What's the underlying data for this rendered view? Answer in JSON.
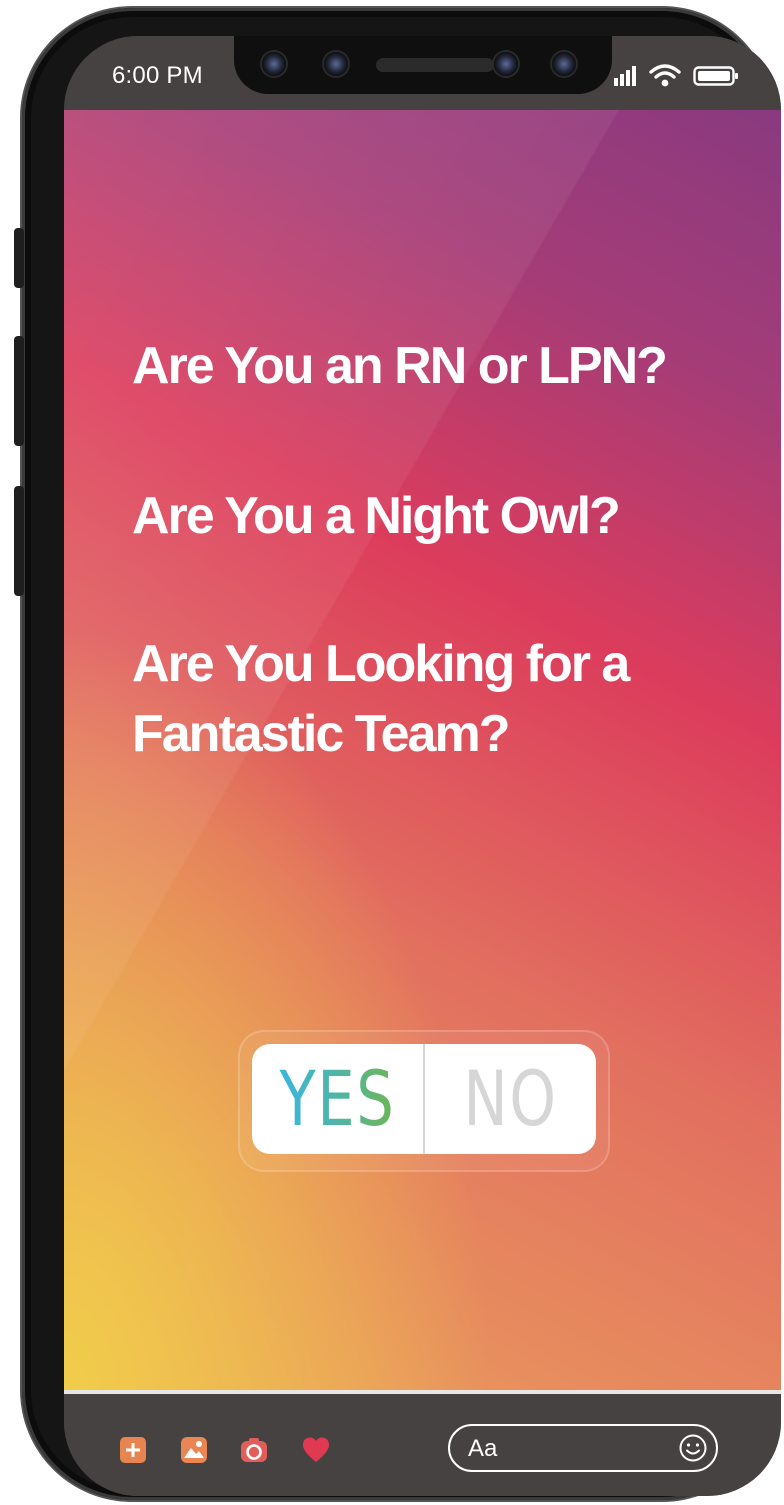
{
  "status_bar": {
    "time": "6:00 PM",
    "icons": [
      "signal-icon",
      "wifi-icon",
      "battery-icon"
    ]
  },
  "story": {
    "headlines": [
      "Are You an RN or LPN?",
      "Are You a Night Owl?",
      "Are You Looking for a",
      "Fantastic Team?"
    ],
    "poll": {
      "yes_label": "YES",
      "no_label": "NO"
    },
    "colors": {
      "gradient_top": "#8a3a80",
      "gradient_mid": "#dc3c5c",
      "gradient_bottom": "#f1cd4a",
      "yes_gradient_start": "#38b7e8",
      "yes_gradient_end": "#74b548",
      "no_color": "#d6d6d6"
    }
  },
  "bottom_bar": {
    "tools": [
      {
        "icon": "add-icon",
        "color": "#e8844f"
      },
      {
        "icon": "gallery-icon",
        "color": "#e98654"
      },
      {
        "icon": "camera-icon",
        "color": "#e35e5a"
      },
      {
        "icon": "heart-icon",
        "color": "#e03a52"
      }
    ],
    "message_placeholder": "Aa",
    "emoji_icon": "smiley-icon"
  }
}
